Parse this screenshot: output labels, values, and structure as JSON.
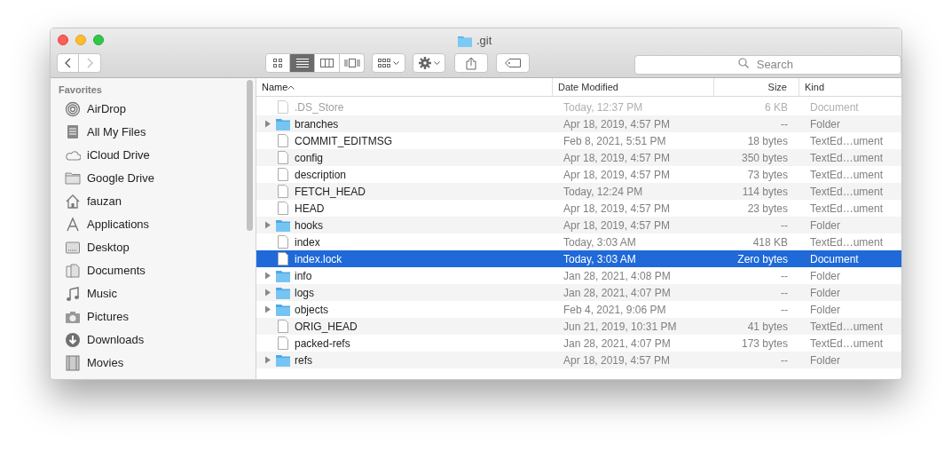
{
  "window": {
    "title": ".git"
  },
  "toolbar": {
    "view_buttons": [
      {
        "kind": "icons",
        "selected": false
      },
      {
        "kind": "list",
        "selected": true
      },
      {
        "kind": "columns",
        "selected": false
      },
      {
        "kind": "coverflow",
        "selected": false
      }
    ],
    "search": {
      "placeholder": "Search"
    }
  },
  "sidebar": {
    "heading": "Favorites",
    "items": [
      {
        "kind": "airdrop",
        "label": "AirDrop"
      },
      {
        "kind": "allfiles",
        "label": "All My Files"
      },
      {
        "kind": "cloud",
        "label": "iCloud Drive"
      },
      {
        "kind": "folder",
        "label": "Google Drive"
      },
      {
        "kind": "home",
        "label": "fauzan"
      },
      {
        "kind": "apps",
        "label": "Applications"
      },
      {
        "kind": "desktop",
        "label": "Desktop"
      },
      {
        "kind": "docs",
        "label": "Documents"
      },
      {
        "kind": "music",
        "label": "Music"
      },
      {
        "kind": "camera",
        "label": "Pictures"
      },
      {
        "kind": "download",
        "label": "Downloads"
      },
      {
        "kind": "film",
        "label": "Movies"
      }
    ]
  },
  "table": {
    "columns": [
      {
        "label": "Name",
        "sorted": true
      },
      {
        "label": "Date Modified",
        "sorted": false
      },
      {
        "label": "Size",
        "sorted": false
      },
      {
        "label": "Kind",
        "sorted": false
      }
    ],
    "rows": [
      {
        "kind": "file",
        "name": ".DS_Store",
        "date": "Today, 12:37 PM",
        "size": "6 KB",
        "type": "Document",
        "selected": false,
        "dimmed": true
      },
      {
        "kind": "folder",
        "name": "branches",
        "date": "Apr 18, 2019, 4:57 PM",
        "size": "--",
        "type": "Folder",
        "selected": false,
        "dimmed": false
      },
      {
        "kind": "file",
        "name": "COMMIT_EDITMSG",
        "date": "Feb 8, 2021, 5:51 PM",
        "size": "18 bytes",
        "type": "TextEd…ument",
        "selected": false,
        "dimmed": false
      },
      {
        "kind": "file",
        "name": "config",
        "date": "Apr 18, 2019, 4:57 PM",
        "size": "350 bytes",
        "type": "TextEd…ument",
        "selected": false,
        "dimmed": false
      },
      {
        "kind": "file",
        "name": "description",
        "date": "Apr 18, 2019, 4:57 PM",
        "size": "73 bytes",
        "type": "TextEd…ument",
        "selected": false,
        "dimmed": false
      },
      {
        "kind": "file",
        "name": "FETCH_HEAD",
        "date": "Today, 12:24 PM",
        "size": "114 bytes",
        "type": "TextEd…ument",
        "selected": false,
        "dimmed": false
      },
      {
        "kind": "file",
        "name": "HEAD",
        "date": "Apr 18, 2019, 4:57 PM",
        "size": "23 bytes",
        "type": "TextEd…ument",
        "selected": false,
        "dimmed": false
      },
      {
        "kind": "folder",
        "name": "hooks",
        "date": "Apr 18, 2019, 4:57 PM",
        "size": "--",
        "type": "Folder",
        "selected": false,
        "dimmed": false
      },
      {
        "kind": "file",
        "name": "index",
        "date": "Today, 3:03 AM",
        "size": "418 KB",
        "type": "TextEd…ument",
        "selected": false,
        "dimmed": false
      },
      {
        "kind": "file",
        "name": "index.lock",
        "date": "Today, 3:03 AM",
        "size": "Zero bytes",
        "type": "Document",
        "selected": true,
        "dimmed": false
      },
      {
        "kind": "folder",
        "name": "info",
        "date": "Jan 28, 2021, 4:08 PM",
        "size": "--",
        "type": "Folder",
        "selected": false,
        "dimmed": false
      },
      {
        "kind": "folder",
        "name": "logs",
        "date": "Jan 28, 2021, 4:07 PM",
        "size": "--",
        "type": "Folder",
        "selected": false,
        "dimmed": false
      },
      {
        "kind": "folder",
        "name": "objects",
        "date": "Feb 4, 2021, 9:06 PM",
        "size": "--",
        "type": "Folder",
        "selected": false,
        "dimmed": false
      },
      {
        "kind": "file",
        "name": "ORIG_HEAD",
        "date": "Jun 21, 2019, 10:31 PM",
        "size": "41 bytes",
        "type": "TextEd…ument",
        "selected": false,
        "dimmed": false
      },
      {
        "kind": "file",
        "name": "packed-refs",
        "date": "Jan 28, 2021, 4:07 PM",
        "size": "173 bytes",
        "type": "TextEd…ument",
        "selected": false,
        "dimmed": false
      },
      {
        "kind": "folder",
        "name": "refs",
        "date": "Apr 18, 2019, 4:57 PM",
        "size": "--",
        "type": "Folder",
        "selected": false,
        "dimmed": false
      }
    ]
  }
}
